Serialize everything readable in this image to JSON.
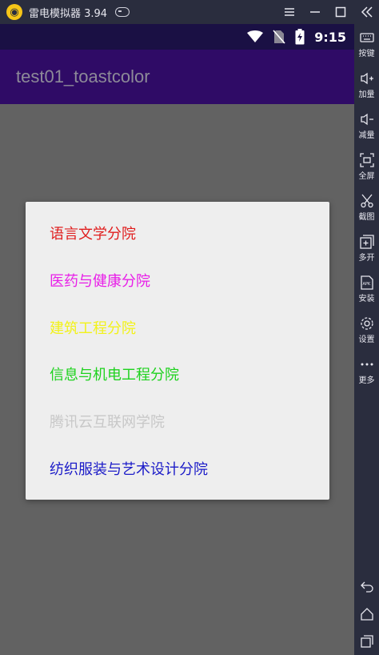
{
  "emulator": {
    "title": "雷电模拟器 3.94",
    "window_buttons": [
      "menu",
      "minimize",
      "maximize",
      "close"
    ]
  },
  "statusbar": {
    "time": "9:15",
    "icons": [
      "wifi-icon",
      "no-sim-icon",
      "battery-charging-icon"
    ]
  },
  "appbar": {
    "title": "test01_toastcolor"
  },
  "dialog": {
    "items": [
      {
        "label": "语言文学分院",
        "color": "#e01e1e"
      },
      {
        "label": "医药与健康分院",
        "color": "#e81ee8"
      },
      {
        "label": "建筑工程分院",
        "color": "#f2f21a"
      },
      {
        "label": "信息与机电工程分院",
        "color": "#1ed21e"
      },
      {
        "label": "腾讯云互联网学院",
        "color": "#c8c8c8"
      },
      {
        "label": "纺织服装与艺术设计分院",
        "color": "#1c1cc8"
      }
    ]
  },
  "sidebar": {
    "items": [
      {
        "label": "按键",
        "icon": "keyboard-icon"
      },
      {
        "label": "加量",
        "icon": "volume-up-icon"
      },
      {
        "label": "减量",
        "icon": "volume-down-icon"
      },
      {
        "label": "全屏",
        "icon": "fullscreen-icon"
      },
      {
        "label": "截图",
        "icon": "scissors-icon"
      },
      {
        "label": "多开",
        "icon": "multi-instance-icon"
      },
      {
        "label": "安装",
        "icon": "apk-install-icon"
      },
      {
        "label": "设置",
        "icon": "gear-icon"
      },
      {
        "label": "更多",
        "icon": "more-icon"
      }
    ],
    "bottom": [
      "back-icon",
      "home-icon",
      "recents-icon"
    ]
  }
}
